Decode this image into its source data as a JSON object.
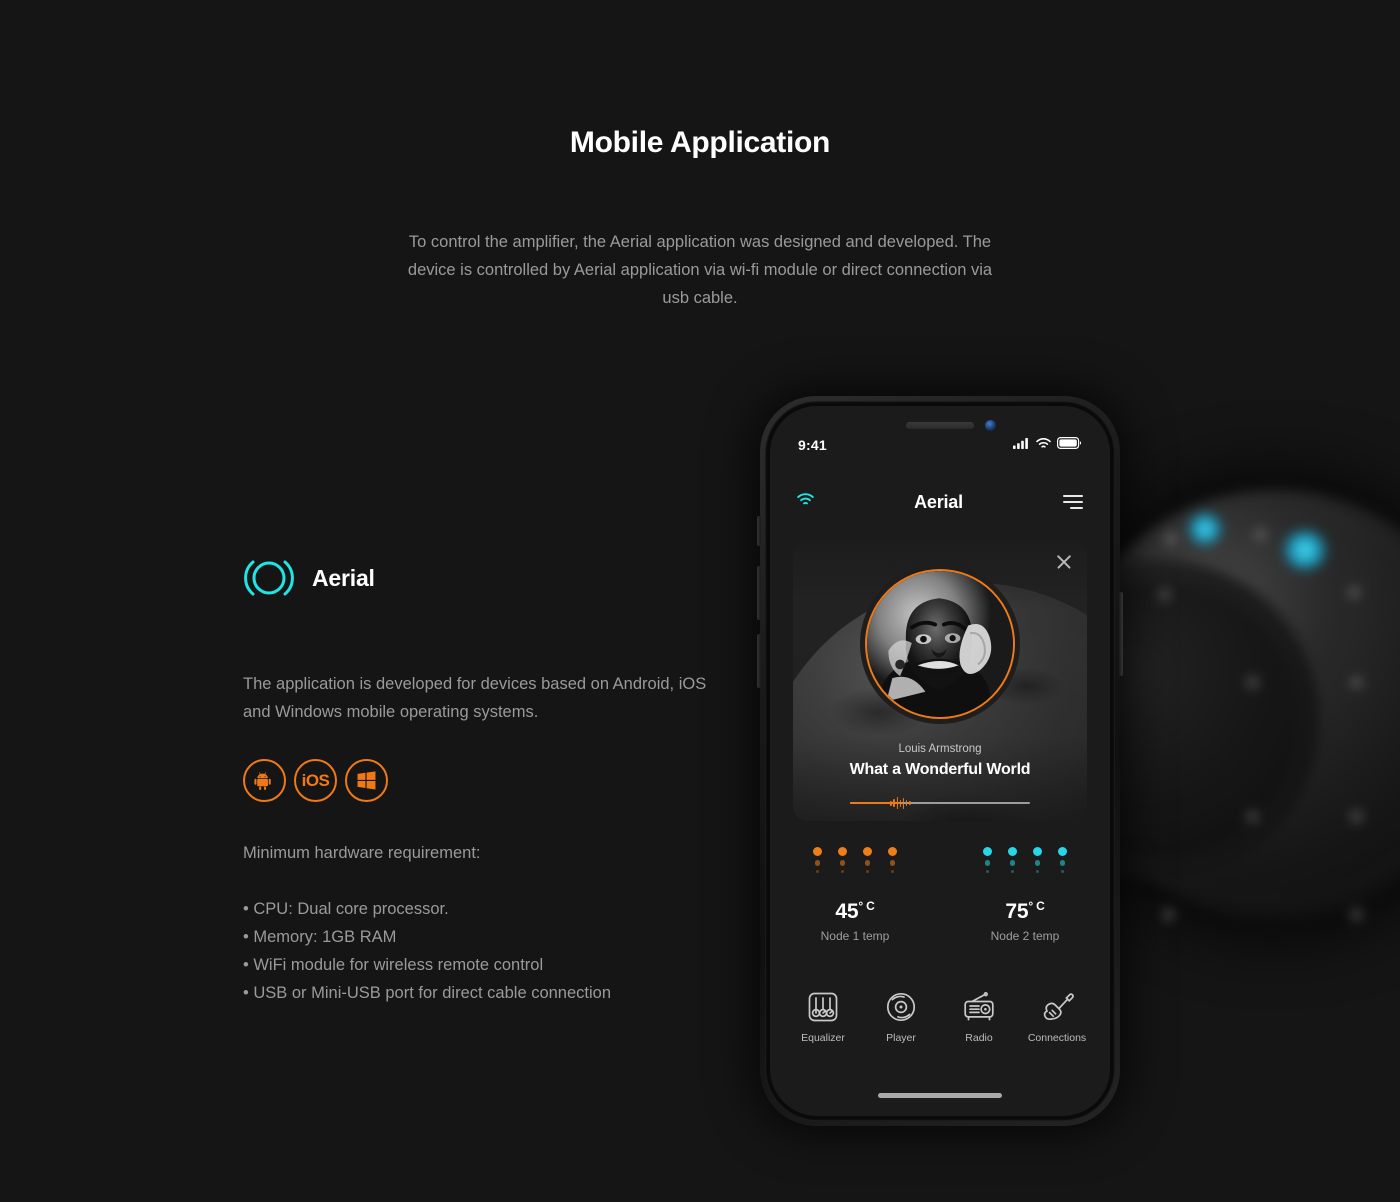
{
  "page": {
    "title": "Mobile Application",
    "intro": "To control the amplifier, the Aerial application was designed and developed. The device is controlled by Aerial application via wi-fi module or direct connection via usb cable."
  },
  "brand": {
    "name": "Aerial",
    "logo_icon": "aerial-circle-logo",
    "accent_cyan": "#20E5E5"
  },
  "left": {
    "description": "The application is developed for devices based on Android, iOS and Windows mobile operating systems.",
    "platforms": [
      {
        "id": "android",
        "label": "Android",
        "icon": "android-icon"
      },
      {
        "id": "ios",
        "label": "iOS",
        "icon": "ios-text-icon"
      },
      {
        "id": "windows",
        "label": "Windows",
        "icon": "windows-icon"
      }
    ],
    "requirements_title": "Minimum hardware requirement:",
    "requirements": [
      "• CPU: Dual core processor.",
      "• Memory: 1GB RAM",
      "• WiFi module for wireless remote control",
      "• USB or Mini-USB port for direct cable connection"
    ],
    "accent_orange": "#EF7A15"
  },
  "phone": {
    "statusbar": {
      "time": "9:41",
      "icons": [
        "signal-bars-icon",
        "wifi-icon",
        "battery-icon"
      ]
    },
    "header": {
      "wifi_icon": "wifi-icon",
      "title": "Aerial",
      "menu_icon": "hamburger-menu-icon"
    },
    "music_card": {
      "close_icon": "close-icon",
      "album_art": "louis-armstrong-portrait",
      "artist": "Louis Armstrong",
      "track": "What a Wonderful World",
      "progress_percent": 28
    },
    "temps": [
      {
        "value": "45",
        "unit": "° C",
        "label": "Node 1 temp",
        "color": "#F07E18",
        "bars": [
          26,
          34,
          44,
          30
        ]
      },
      {
        "value": "75",
        "unit": "° C",
        "label": "Node 2 temp",
        "color": "#27D7E8",
        "bars": [
          30,
          26,
          36,
          44
        ]
      }
    ],
    "nav": [
      {
        "label": "Equalizer",
        "icon": "equalizer-icon"
      },
      {
        "label": "Player",
        "icon": "vinyl-disc-icon"
      },
      {
        "label": "Radio",
        "icon": "radio-icon"
      },
      {
        "label": "Connections",
        "icon": "guitar-icon"
      }
    ],
    "home_indicator": "home-indicator"
  }
}
